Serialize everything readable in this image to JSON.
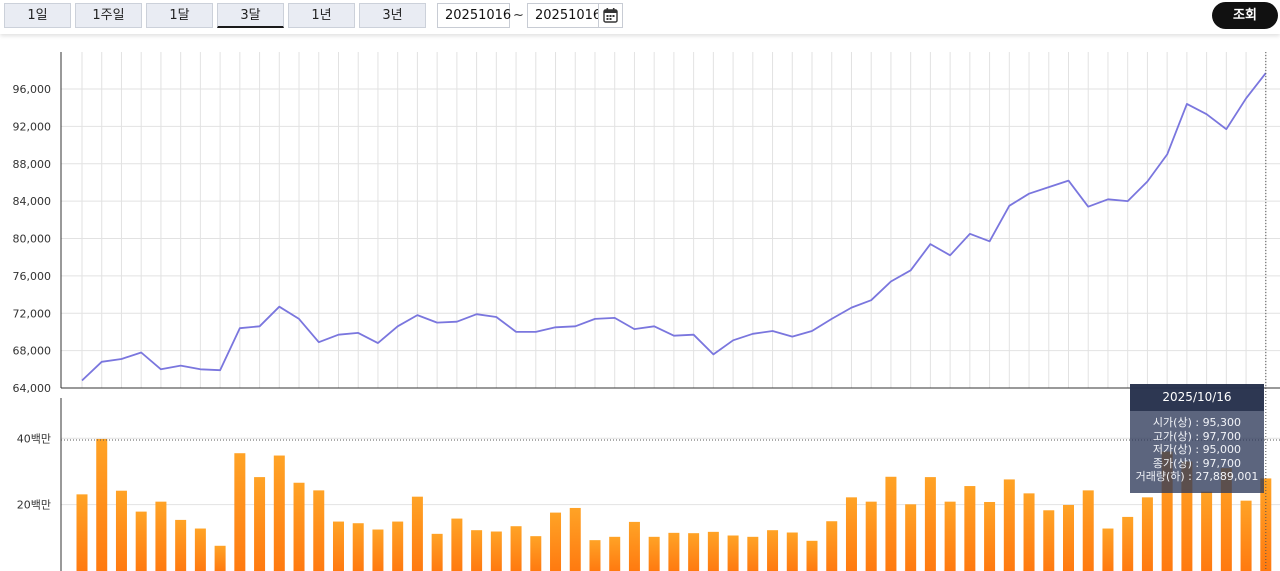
{
  "toolbar": {
    "periods": [
      "1일",
      "1주일",
      "1달",
      "3달",
      "1년",
      "3년"
    ],
    "active_period": "3달",
    "start_date": "20251016",
    "end_date": "20251016",
    "separator": "~",
    "search_label": "조회"
  },
  "tooltip": {
    "date": "2025/10/16",
    "open": "시가(상) : 95,300",
    "high": "고가(상) : 97,700",
    "low": "저가(상) : 95,000",
    "close": "종가(상) : 97,700",
    "volume": "거래량(하) : 27,889,001"
  },
  "colors": {
    "price_line": "#7a76de",
    "volume_bar_top": "#ffa326",
    "volume_bar_bottom": "#ff7a10",
    "grid": "#e2e2e2",
    "axis": "#333333"
  },
  "chart_data": [
    {
      "type": "line",
      "name": "price",
      "ylim": [
        64000,
        100000
      ],
      "yticks": [
        64000,
        68000,
        72000,
        76000,
        80000,
        84000,
        88000,
        92000,
        96000
      ],
      "ytick_labels": [
        "64,000",
        "68,000",
        "72,000",
        "76,000",
        "80,000",
        "84,000",
        "88,000",
        "92,000",
        "96,000"
      ],
      "grid": true,
      "values": [
        64800,
        66800,
        67100,
        67800,
        66000,
        66400,
        66000,
        65900,
        70400,
        70600,
        72700,
        71400,
        68900,
        69700,
        69900,
        68800,
        70600,
        71800,
        71000,
        71100,
        71900,
        71600,
        70000,
        70000,
        70500,
        70600,
        71400,
        71500,
        70300,
        70600,
        69600,
        69700,
        67600,
        69100,
        69800,
        70100,
        69500,
        70100,
        71400,
        72600,
        73400,
        75400,
        76600,
        79400,
        78200,
        80500,
        79700,
        83500,
        84800,
        85500,
        86200,
        83400,
        84200,
        84000,
        86100,
        89000,
        94400,
        93300,
        91700,
        95000,
        97700
      ]
    },
    {
      "type": "bar",
      "name": "volume",
      "unit": "백만",
      "yticks": [
        20,
        40
      ],
      "ytick_labels": [
        "20백만",
        "40백만"
      ],
      "values": [
        23.1,
        39.8,
        24.2,
        17.9,
        20.9,
        15.4,
        12.8,
        7.6,
        35.5,
        28.3,
        34.8,
        26.6,
        24.3,
        14.9,
        14.4,
        12.5,
        14.9,
        22.4,
        11.2,
        15.8,
        12.3,
        11.9,
        13.5,
        10.5,
        17.6,
        19.0,
        9.3,
        10.3,
        14.8,
        10.3,
        11.5,
        11.4,
        11.8,
        10.7,
        10.3,
        12.3,
        11.6,
        9.1,
        15.0,
        22.2,
        20.9,
        28.4,
        20.1,
        28.3,
        20.9,
        25.6,
        20.8,
        27.6,
        23.4,
        18.3,
        19.9,
        24.3,
        12.8,
        16.3,
        22.2,
        36.0,
        33.0,
        23.9,
        31.0,
        21.2,
        27.9
      ]
    }
  ]
}
